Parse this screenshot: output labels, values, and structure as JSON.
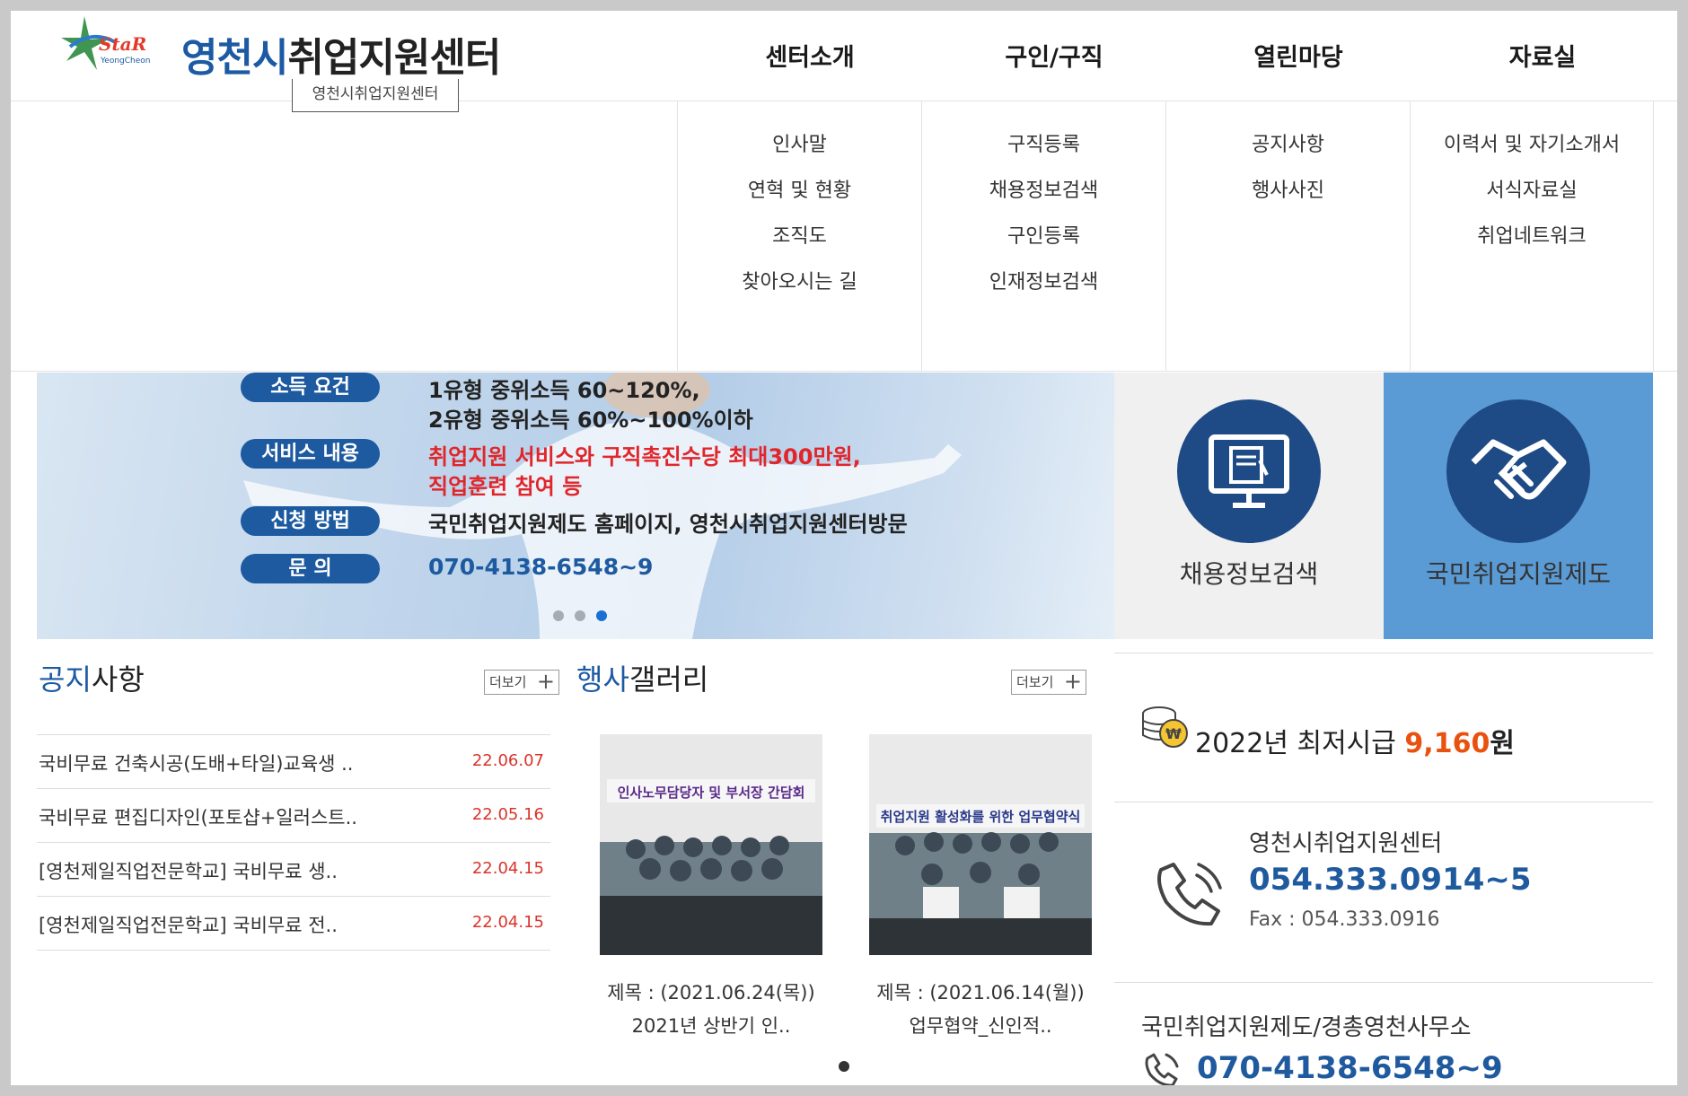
{
  "header": {
    "logo_text_blue": "영천시",
    "logo_text_rest": "취업지원센터",
    "site_tag": "영천시취업지원센터",
    "nav": [
      "센터소개",
      "구인/구직",
      "열린마당",
      "자료실"
    ]
  },
  "dropdown": {
    "col1": [
      "인사말",
      "연혁 및 현황",
      "조직도",
      "찾아오시는 길"
    ],
    "col2": [
      "구직등록",
      "채용정보검색",
      "구인등록",
      "인재정보검색"
    ],
    "col3": [
      "공지사항",
      "행사사진"
    ],
    "col4": [
      "이력서 및 자기소개서",
      "서식자료실",
      "취업네트워크"
    ]
  },
  "banner": {
    "pill1": "소득 요건",
    "text1a": "1유형 중위소득 60~120%,",
    "text1b": "2유형 중위소득 60%~100%이하",
    "pill2": "서비스 내용",
    "text2a": "취업지원 서비스와 구직촉진수당 최대300만원,",
    "text2b": "직업훈련 참여 등",
    "pill3": "신청 방법",
    "text3": "국민취업지원제도 홈페이지, 영천시취업지원센터방문",
    "pill4": "문 의",
    "text4": "070-4138-6548~9"
  },
  "quick": {
    "job_search": "채용정보검색",
    "national_support": "국민취업지원제도"
  },
  "notice": {
    "title_blue": "공지",
    "title_rest": "사항",
    "more": "더보기",
    "items": [
      {
        "title": "국비무료 건축시공(도배+타일)교육생 ..",
        "date": "22.06.07"
      },
      {
        "title": "국비무료 편집디자인(포토샵+일러스트..",
        "date": "22.05.16"
      },
      {
        "title": "[영천제일직업전문학교] 국비무료 생..",
        "date": "22.04.15"
      },
      {
        "title": "[영천제일직업전문학교] 국비무료 전..",
        "date": "22.04.15"
      }
    ]
  },
  "gallery": {
    "title_blue": "행사",
    "title_rest": "갤러리",
    "more": "더보기",
    "items": [
      {
        "banner_text": "인사노무담당자 및 부서장 간담회",
        "caption1": "제목 : (2021.06.24(목))",
        "caption2": "2021년 상반기 인.."
      },
      {
        "banner_text": "취업지원 활성화를 위한 업무협약식",
        "caption1": "제목 : (2021.06.14(월))",
        "caption2": "업무협약_신인적.."
      }
    ]
  },
  "info": {
    "wage_prefix": "2022년 최저시급 ",
    "wage_amount": "9,160",
    "wage_unit": "원",
    "center_name": "영천시취업지원센터",
    "center_phone": "054.333.0914~5",
    "center_fax": "Fax : 054.333.0916",
    "kukmin_name": "국민취업지원제도/경총영천사무소",
    "kukmin_phone": "070-4138-6548~9"
  },
  "colors": {
    "brand_blue": "#1c5aa3",
    "date_red": "#d9342b",
    "wage_orange": "#e8520e"
  }
}
